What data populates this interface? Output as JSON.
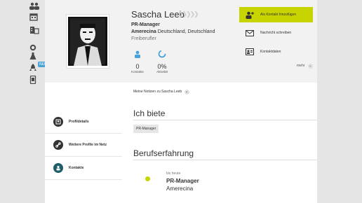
{
  "badge_text": "NEU",
  "profile": {
    "name": "Sascha Leeb",
    "job_title": "PR-Manager",
    "company": "Amerecina",
    "location": "Deutschland, Deutschland",
    "status": "Freiberufler"
  },
  "stats": {
    "contacts_value": "0",
    "contacts_label": "Kontakte",
    "activity_value": "0%",
    "activity_label": "Aktivität"
  },
  "actions": {
    "add_contact": "Als Kontakt hinzufügen",
    "write_message": "Nachricht schreiben",
    "contact_data": "Kontaktdaten",
    "more": "mehr"
  },
  "notes_label": "Meine Notizen zu Sascha Leeb",
  "sidebar": {
    "items": [
      {
        "label": "Profildetails"
      },
      {
        "label": "Weitere Profile im Netz"
      },
      {
        "label": "Kontakte"
      }
    ]
  },
  "offer": {
    "heading": "Ich biete",
    "tags": [
      "PR-Manager"
    ]
  },
  "experience": {
    "heading": "Berufserfahrung",
    "period": "bis heute",
    "job_title": "PR-Manager",
    "company": "Amerecina"
  },
  "colors": {
    "accent": "#c8d400",
    "teal": "#1e5e6a",
    "blue_badge": "#4aa3d6"
  }
}
